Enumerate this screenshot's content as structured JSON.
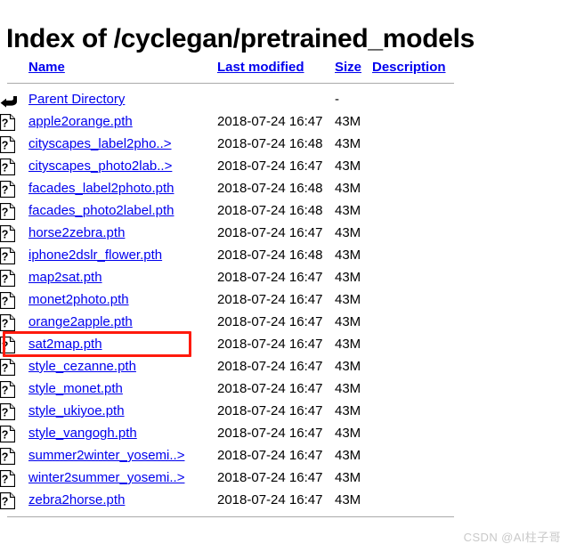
{
  "page": {
    "title": "Index of /cyclegan/pretrained_models"
  },
  "table": {
    "headers": {
      "name": "Name",
      "last_modified": "Last modified",
      "size": "Size",
      "description": "Description"
    },
    "parent": {
      "label": "Parent Directory",
      "last_modified": "",
      "size": "-",
      "description": "",
      "icon": "back-arrow-icon"
    },
    "rows": [
      {
        "name": "apple2orange.pth",
        "last_modified": "2018-07-24 16:47",
        "size": "43M",
        "description": "",
        "icon": "unknown-file-icon",
        "highlighted": false
      },
      {
        "name": "cityscapes_label2pho..>",
        "last_modified": "2018-07-24 16:48",
        "size": "43M",
        "description": "",
        "icon": "unknown-file-icon",
        "highlighted": false
      },
      {
        "name": "cityscapes_photo2lab..>",
        "last_modified": "2018-07-24 16:47",
        "size": "43M",
        "description": "",
        "icon": "unknown-file-icon",
        "highlighted": false
      },
      {
        "name": "facades_label2photo.pth",
        "last_modified": "2018-07-24 16:48",
        "size": "43M",
        "description": "",
        "icon": "unknown-file-icon",
        "highlighted": false
      },
      {
        "name": "facades_photo2label.pth",
        "last_modified": "2018-07-24 16:48",
        "size": "43M",
        "description": "",
        "icon": "unknown-file-icon",
        "highlighted": false
      },
      {
        "name": "horse2zebra.pth",
        "last_modified": "2018-07-24 16:47",
        "size": "43M",
        "description": "",
        "icon": "unknown-file-icon",
        "highlighted": false
      },
      {
        "name": "iphone2dslr_flower.pth",
        "last_modified": "2018-07-24 16:48",
        "size": "43M",
        "description": "",
        "icon": "unknown-file-icon",
        "highlighted": false
      },
      {
        "name": "map2sat.pth",
        "last_modified": "2018-07-24 16:47",
        "size": "43M",
        "description": "",
        "icon": "unknown-file-icon",
        "highlighted": false
      },
      {
        "name": "monet2photo.pth",
        "last_modified": "2018-07-24 16:47",
        "size": "43M",
        "description": "",
        "icon": "unknown-file-icon",
        "highlighted": false
      },
      {
        "name": "orange2apple.pth",
        "last_modified": "2018-07-24 16:47",
        "size": "43M",
        "description": "",
        "icon": "unknown-file-icon",
        "highlighted": false
      },
      {
        "name": "sat2map.pth",
        "last_modified": "2018-07-24 16:47",
        "size": "43M",
        "description": "",
        "icon": "unknown-file-icon",
        "highlighted": true
      },
      {
        "name": "style_cezanne.pth",
        "last_modified": "2018-07-24 16:47",
        "size": "43M",
        "description": "",
        "icon": "unknown-file-icon",
        "highlighted": false
      },
      {
        "name": "style_monet.pth",
        "last_modified": "2018-07-24 16:47",
        "size": "43M",
        "description": "",
        "icon": "unknown-file-icon",
        "highlighted": false
      },
      {
        "name": "style_ukiyoe.pth",
        "last_modified": "2018-07-24 16:47",
        "size": "43M",
        "description": "",
        "icon": "unknown-file-icon",
        "highlighted": false
      },
      {
        "name": "style_vangogh.pth",
        "last_modified": "2018-07-24 16:47",
        "size": "43M",
        "description": "",
        "icon": "unknown-file-icon",
        "highlighted": false
      },
      {
        "name": "summer2winter_yosemi..>",
        "last_modified": "2018-07-24 16:47",
        "size": "43M",
        "description": "",
        "icon": "unknown-file-icon",
        "highlighted": false
      },
      {
        "name": "winter2summer_yosemi..>",
        "last_modified": "2018-07-24 16:47",
        "size": "43M",
        "description": "",
        "icon": "unknown-file-icon",
        "highlighted": false
      },
      {
        "name": "zebra2horse.pth",
        "last_modified": "2018-07-24 16:47",
        "size": "43M",
        "description": "",
        "icon": "unknown-file-icon",
        "highlighted": false
      }
    ]
  },
  "annotation": {
    "highlight_color": "#FF1A0D",
    "highlight_target": "sat2map.pth"
  },
  "watermark": {
    "text": "CSDN @AI柱子哥",
    "color": "#c9c9c9"
  },
  "colors": {
    "link": "#0000EE",
    "text": "#000000",
    "rule": "#aaaaaa",
    "background": "#ffffff"
  }
}
